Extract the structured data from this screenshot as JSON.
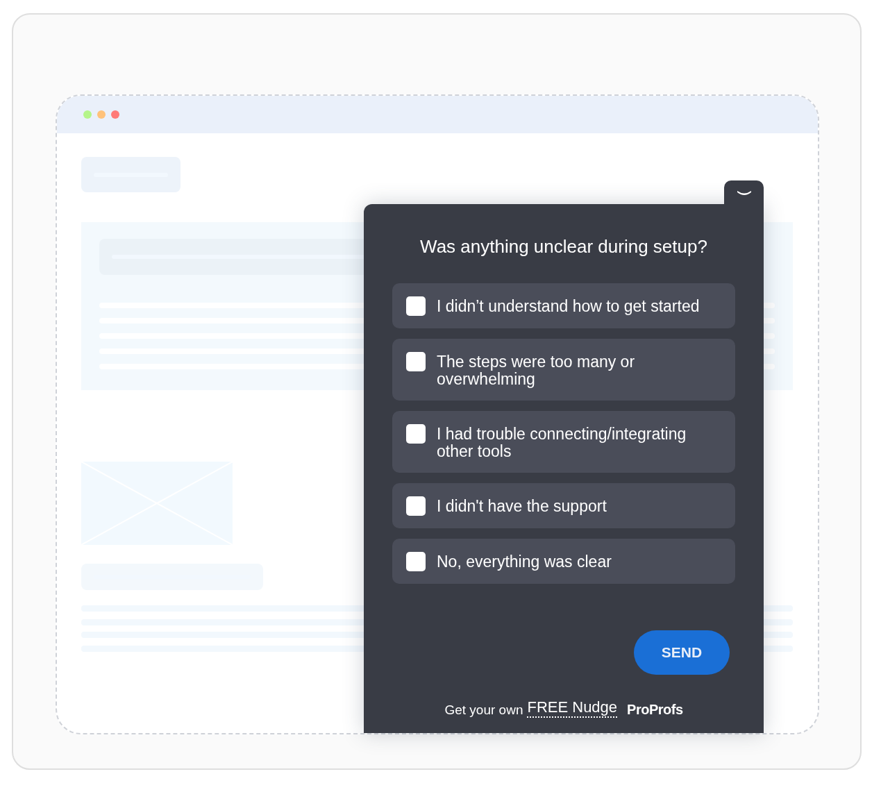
{
  "browser": {
    "dots": [
      {
        "color": "#b5f58a"
      },
      {
        "color": "#ffc27a"
      },
      {
        "color": "#ff7a78"
      }
    ]
  },
  "survey": {
    "question": "Was anything unclear during setup?",
    "options": [
      {
        "label": "I didn’t understand how to get started",
        "checked": false
      },
      {
        "label": "The steps were too many or overwhelming",
        "checked": false
      },
      {
        "label": "I had trouble connecting/integrating other tools",
        "checked": false
      },
      {
        "label": "I didn't have the support",
        "checked": false
      },
      {
        "label": "No, everything was clear",
        "checked": false
      }
    ],
    "send_button": "SEND",
    "footer": {
      "text": "Get your own",
      "link": "FREE Nudge",
      "brand": "ProProfs"
    }
  }
}
